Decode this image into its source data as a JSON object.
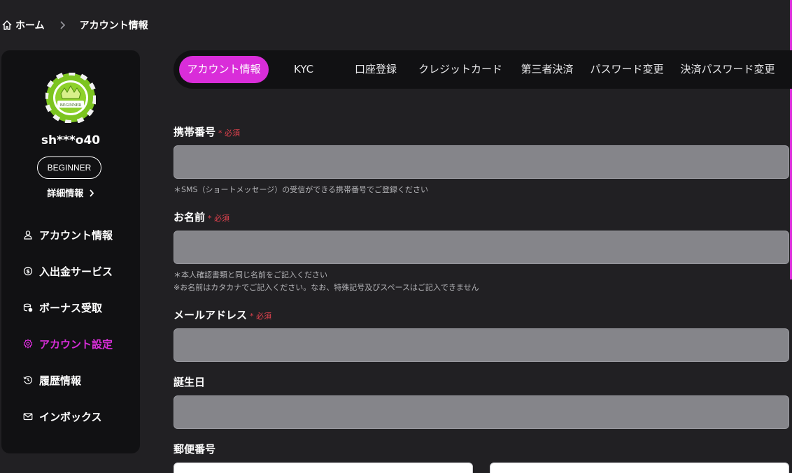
{
  "breadcrumb": {
    "home": "ホーム",
    "current": "アカウント情報"
  },
  "sidebar": {
    "avatar_alt": "BEGINNER",
    "username": "sh***o40",
    "rank": "BEGINNER",
    "details_link": "詳細情報",
    "items": [
      {
        "label": "アカウント情報",
        "icon": "user-icon"
      },
      {
        "label": "入出金サービス",
        "icon": "coin-icon"
      },
      {
        "label": "ボーナス受取",
        "icon": "bonus-icon"
      },
      {
        "label": "アカウント設定",
        "icon": "gear-icon"
      },
      {
        "label": "履歴情報",
        "icon": "history-icon"
      },
      {
        "label": "インボックス",
        "icon": "mail-icon"
      }
    ]
  },
  "tabs": [
    {
      "label": "アカウント情報"
    },
    {
      "label": "KYC"
    },
    {
      "label": "口座登録"
    },
    {
      "label": "クレジットカード"
    },
    {
      "label": "第三者決済"
    },
    {
      "label": "パスワード変更"
    },
    {
      "label": "決済パスワード変更"
    }
  ],
  "form": {
    "phone": {
      "label": "携帯番号",
      "required": "* 必須",
      "value": "",
      "hint": "＊SMS（ショートメッセージ）の受信ができる携帯番号でご登録ください"
    },
    "name": {
      "label": "お名前",
      "required": "* 必須",
      "value": "",
      "hint1": "＊本人確認書類と同じ名前をご記入ください",
      "hint2": "※お名前はカタカナでご記入ください。なお、特殊記号及びスペースはご記入できません"
    },
    "email": {
      "label": "メールアドレス",
      "required": "* 必須",
      "value": ""
    },
    "birthday": {
      "label": "誕生日",
      "value": ""
    },
    "postal": {
      "label": "郵便番号",
      "value1": "",
      "value2": ""
    }
  },
  "colors": {
    "accent": "#d92dd9",
    "required": "#e2424e",
    "sidebar_bg": "#111113",
    "page_bg": "#212023",
    "input_bg": "#85858a"
  }
}
